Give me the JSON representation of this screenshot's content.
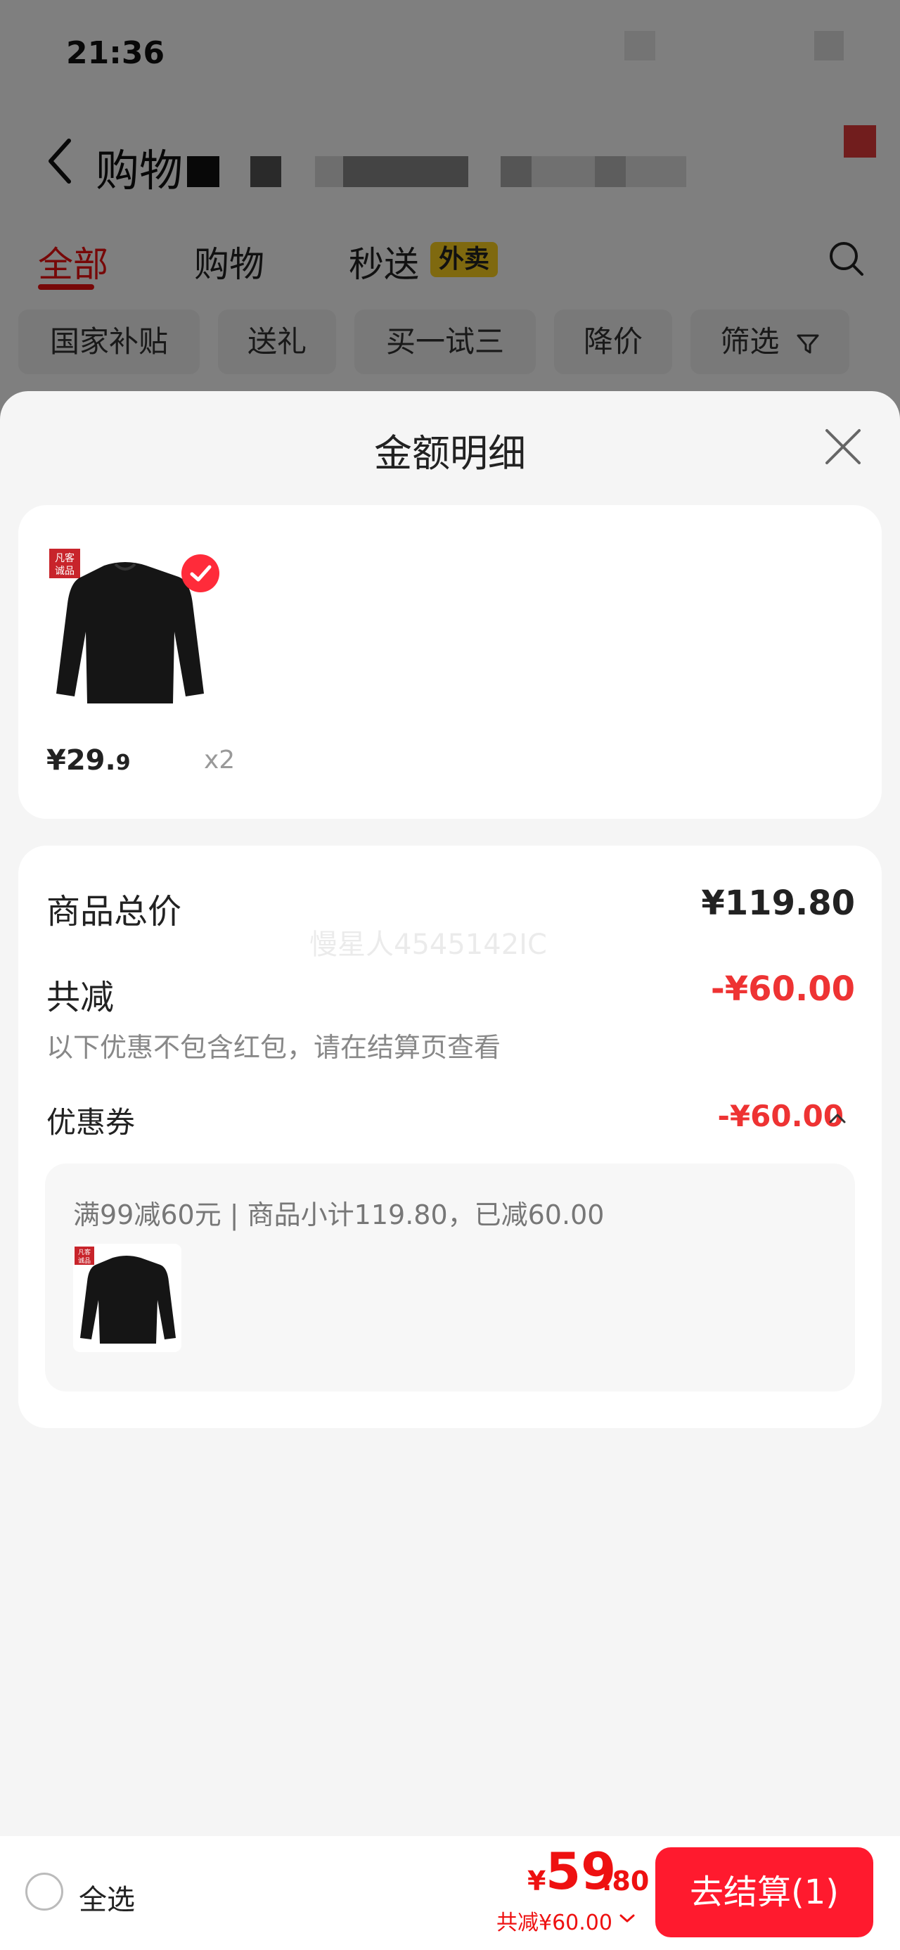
{
  "status_bar": {
    "time": "21:36"
  },
  "header": {
    "title": "购物"
  },
  "tabs": [
    {
      "label": "全部",
      "active": true
    },
    {
      "label": "购物",
      "active": false
    },
    {
      "label": "秒送",
      "active": false,
      "tag": "外卖"
    }
  ],
  "chips": [
    {
      "label": "国家补贴"
    },
    {
      "label": "送礼"
    },
    {
      "label": "买一试三"
    },
    {
      "label": "降价"
    },
    {
      "label": "筛选"
    }
  ],
  "sheet": {
    "title": "金额明细",
    "product": {
      "price_int": "¥29.",
      "price_dec": "9",
      "quantity": "x2",
      "badge_text": "凡客诚品"
    },
    "total_label": "商品总价",
    "total_amount": "¥119.80",
    "discount_label": "共减",
    "discount_amount": "-¥60.00",
    "discount_note": "以下优惠不包含红包，请在结算页查看",
    "coupon_label": "优惠券",
    "coupon_amount": "-¥60.00",
    "coupon_desc": "满99减60元 | 商品小计119.80，已减60.00",
    "watermark": "慢星人4545142IC"
  },
  "bottom_bar": {
    "select_all": "全选",
    "currency": "¥",
    "total_int": "59",
    "total_dec": ".80",
    "saved": "共减¥60.00",
    "checkout": "去结算(1)"
  },
  "colors": {
    "accent_red": "#ff1a2e",
    "discount_red": "#e33333",
    "waimai_yellow": "#ffd21f"
  }
}
